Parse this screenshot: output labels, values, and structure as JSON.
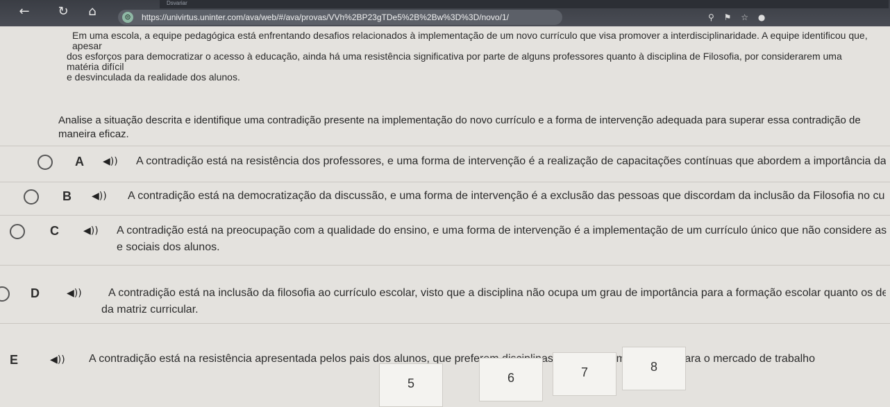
{
  "browser": {
    "tab_title": "Dsvariar",
    "url": "https://univirtus.uninter.com/ava/web/#/ava/provas/VVh%2BP23gTDe5%2B%2Bw%3D%3D/novo/1/"
  },
  "exam": {
    "context_line1": "Em uma escola, a equipe pedagógica está enfrentando desafios relacionados à implementação de um novo currículo que visa promover a interdisciplinaridade. A equipe identificou que, apesar",
    "context_line2": "dos esforços para democratizar o acesso à educação, ainda há uma resistência significativa por parte de alguns professores quanto à disciplina de Filosofia, por considerarem uma matéria difícil",
    "context_line3": "e desvinculada da realidade dos alunos.",
    "question": "Analise a situação descrita e identifique uma contradição presente na implementação do novo currículo e a forma de intervenção adequada para superar essa contradição de maneira eficaz.",
    "options": [
      {
        "letter": "A",
        "text": "A contradição está na resistência dos professores, e uma forma de intervenção é a realização de capacitações contínuas que abordem a importância da Filosofia nos currículos."
      },
      {
        "letter": "B",
        "text": "A contradição está na democratização da discussão, e uma forma de intervenção é a exclusão das pessoas que discordam da inclusão da Filosofia no currículo escolar."
      },
      {
        "letter": "C",
        "text": "A contradição está na preocupação com a qualidade do ensino, e uma forma de intervenção é a implementação de um currículo único que não considere as diferenças culturais",
        "text2": "e sociais dos alunos."
      },
      {
        "letter": "D",
        "text": "A contradição está na inclusão da filosofia ao currículo escolar, visto que a disciplina não ocupa um grau de importância para a formação escolar quanto os demais componentes",
        "text2": "da matriz curricular."
      },
      {
        "letter": "E",
        "text": "A contradição está na resistência apresentada pelos pais dos alunos, que preferem disciplinas que preparem os jovens para o mercado de trabalho"
      }
    ]
  },
  "pagination": {
    "pages": [
      "5",
      "6",
      "7",
      "8"
    ]
  }
}
